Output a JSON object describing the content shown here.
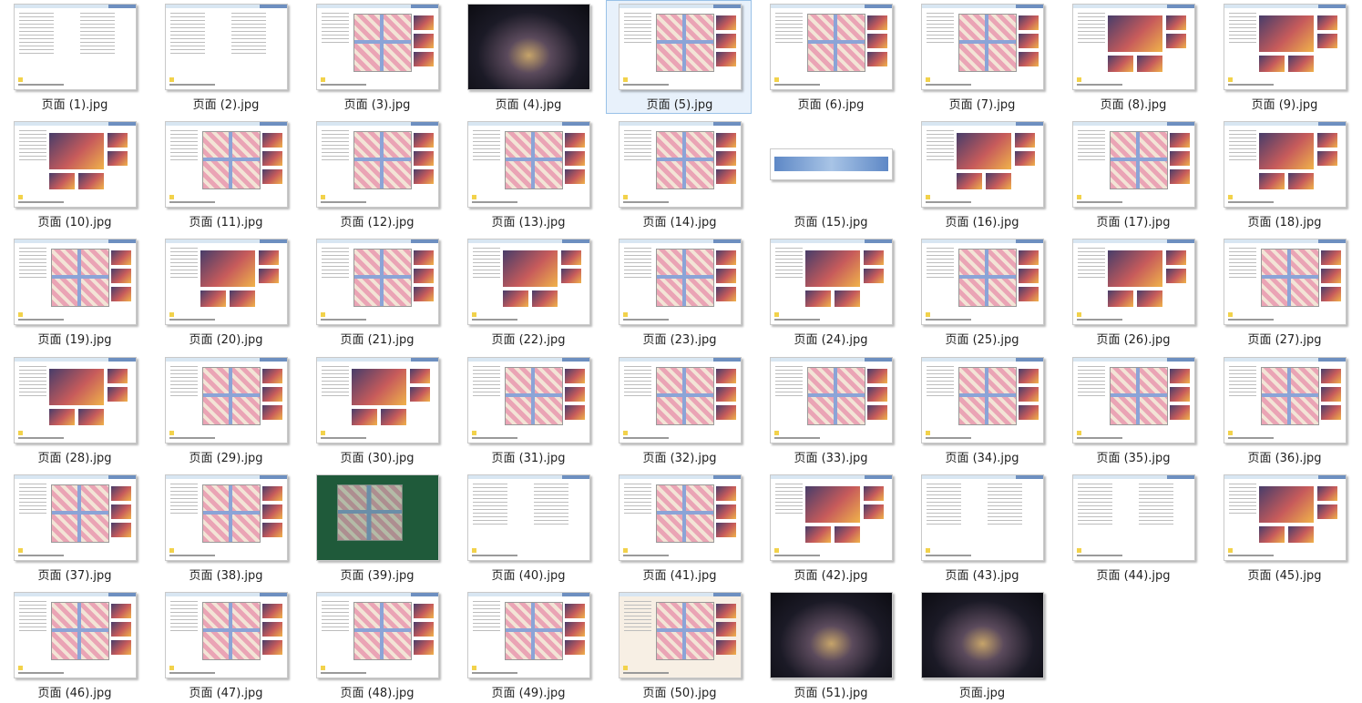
{
  "files": [
    {
      "name": "页面 (1).jpg",
      "kind": "text"
    },
    {
      "name": "页面 (2).jpg",
      "kind": "text"
    },
    {
      "name": "页面 (3).jpg",
      "kind": "plan"
    },
    {
      "name": "页面 (4).jpg",
      "kind": "night"
    },
    {
      "name": "页面 (5).jpg",
      "kind": "plan",
      "selected": true
    },
    {
      "name": "页面 (6).jpg",
      "kind": "map"
    },
    {
      "name": "页面 (7).jpg",
      "kind": "plan"
    },
    {
      "name": "页面 (8).jpg",
      "kind": "photos"
    },
    {
      "name": "页面 (9).jpg",
      "kind": "photos"
    },
    {
      "name": "页面 (10).jpg",
      "kind": "photos"
    },
    {
      "name": "页面 (11).jpg",
      "kind": "plan"
    },
    {
      "name": "页面 (12).jpg",
      "kind": "plan"
    },
    {
      "name": "页面 (13).jpg",
      "kind": "plan"
    },
    {
      "name": "页面 (14).jpg",
      "kind": "plan"
    },
    {
      "name": "页面 (15).jpg",
      "kind": "panorama"
    },
    {
      "name": "页面 (16).jpg",
      "kind": "photos"
    },
    {
      "name": "页面 (17).jpg",
      "kind": "plan"
    },
    {
      "name": "页面 (18).jpg",
      "kind": "photos"
    },
    {
      "name": "页面 (19).jpg",
      "kind": "plan"
    },
    {
      "name": "页面 (20).jpg",
      "kind": "photos"
    },
    {
      "name": "页面 (21).jpg",
      "kind": "plan"
    },
    {
      "name": "页面 (22).jpg",
      "kind": "photos"
    },
    {
      "name": "页面 (23).jpg",
      "kind": "plan"
    },
    {
      "name": "页面 (24).jpg",
      "kind": "photos"
    },
    {
      "name": "页面 (25).jpg",
      "kind": "plan"
    },
    {
      "name": "页面 (26).jpg",
      "kind": "photos"
    },
    {
      "name": "页面 (27).jpg",
      "kind": "plan"
    },
    {
      "name": "页面 (28).jpg",
      "kind": "photos"
    },
    {
      "name": "页面 (29).jpg",
      "kind": "plan"
    },
    {
      "name": "页面 (30).jpg",
      "kind": "photos"
    },
    {
      "name": "页面 (31).jpg",
      "kind": "plan"
    },
    {
      "name": "页面 (32).jpg",
      "kind": "plan"
    },
    {
      "name": "页面 (33).jpg",
      "kind": "plan"
    },
    {
      "name": "页面 (34).jpg",
      "kind": "plan"
    },
    {
      "name": "页面 (35).jpg",
      "kind": "plan"
    },
    {
      "name": "页面 (36).jpg",
      "kind": "plan"
    },
    {
      "name": "页面 (37).jpg",
      "kind": "plan"
    },
    {
      "name": "页面 (38).jpg",
      "kind": "plan"
    },
    {
      "name": "页面 (39).jpg",
      "kind": "green"
    },
    {
      "name": "页面 (40).jpg",
      "kind": "table"
    },
    {
      "name": "页面 (41).jpg",
      "kind": "diagram"
    },
    {
      "name": "页面 (42).jpg",
      "kind": "photos"
    },
    {
      "name": "页面 (43).jpg",
      "kind": "text"
    },
    {
      "name": "页面 (44).jpg",
      "kind": "text"
    },
    {
      "name": "页面 (45).jpg",
      "kind": "photos"
    },
    {
      "name": "页面 (46).jpg",
      "kind": "sketch"
    },
    {
      "name": "页面 (47).jpg",
      "kind": "plan"
    },
    {
      "name": "页面 (48).jpg",
      "kind": "plan"
    },
    {
      "name": "页面 (49).jpg",
      "kind": "plan"
    },
    {
      "name": "页面 (50).jpg",
      "kind": "cream"
    },
    {
      "name": "页面 (51).jpg",
      "kind": "night"
    },
    {
      "name": "页面.jpg",
      "kind": "night"
    }
  ]
}
